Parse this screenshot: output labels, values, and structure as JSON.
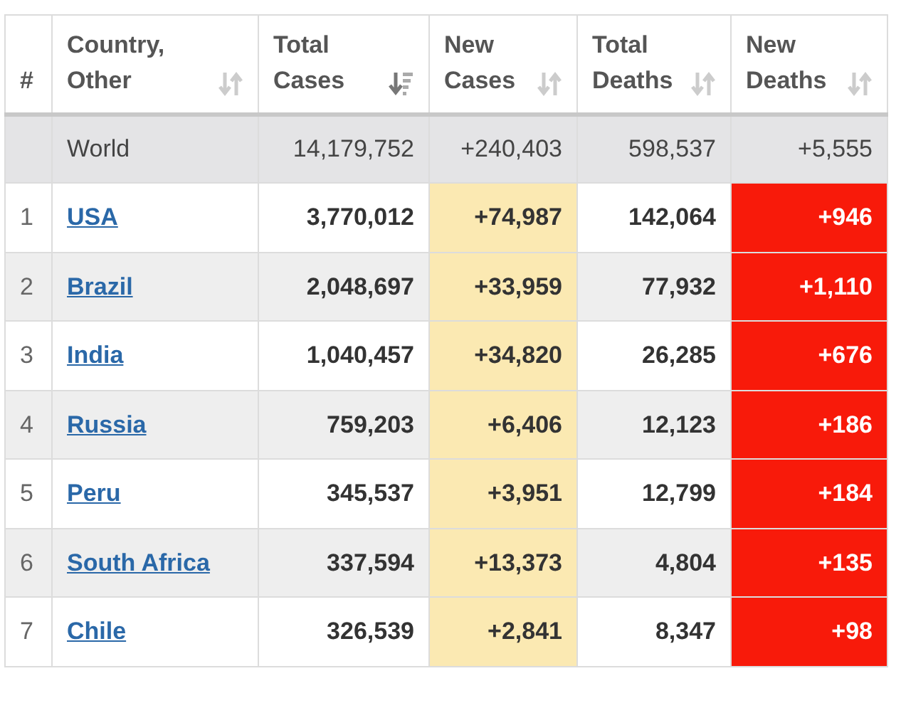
{
  "table": {
    "columns": [
      {
        "label": "#"
      },
      {
        "label": "Country,\nOther",
        "sorted": false
      },
      {
        "label": "Total\nCases",
        "sorted": true
      },
      {
        "label": "New\nCases",
        "sorted": false
      },
      {
        "label": "Total\nDeaths",
        "sorted": false
      },
      {
        "label": "New\nDeaths",
        "sorted": false
      }
    ],
    "world_row": {
      "name": "World",
      "total_cases": "14,179,752",
      "new_cases": "+240,403",
      "total_deaths": "598,537",
      "new_deaths": "+5,555"
    },
    "rows": [
      {
        "rank": "1",
        "country": "USA",
        "total_cases": "3,770,012",
        "new_cases": "+74,987",
        "total_deaths": "142,064",
        "new_deaths": "+946"
      },
      {
        "rank": "2",
        "country": "Brazil",
        "total_cases": "2,048,697",
        "new_cases": "+33,959",
        "total_deaths": "77,932",
        "new_deaths": "+1,110"
      },
      {
        "rank": "3",
        "country": "India",
        "total_cases": "1,040,457",
        "new_cases": "+34,820",
        "total_deaths": "26,285",
        "new_deaths": "+676"
      },
      {
        "rank": "4",
        "country": "Russia",
        "total_cases": "759,203",
        "new_cases": "+6,406",
        "total_deaths": "12,123",
        "new_deaths": "+186"
      },
      {
        "rank": "5",
        "country": "Peru",
        "total_cases": "345,537",
        "new_cases": "+3,951",
        "total_deaths": "12,799",
        "new_deaths": "+184"
      },
      {
        "rank": "6",
        "country": "South Africa",
        "total_cases": "337,594",
        "new_cases": "+13,373",
        "total_deaths": "4,804",
        "new_deaths": "+135"
      },
      {
        "rank": "7",
        "country": "Chile",
        "total_cases": "326,539",
        "new_cases": "+2,841",
        "total_deaths": "8,347",
        "new_deaths": "+98"
      }
    ]
  }
}
